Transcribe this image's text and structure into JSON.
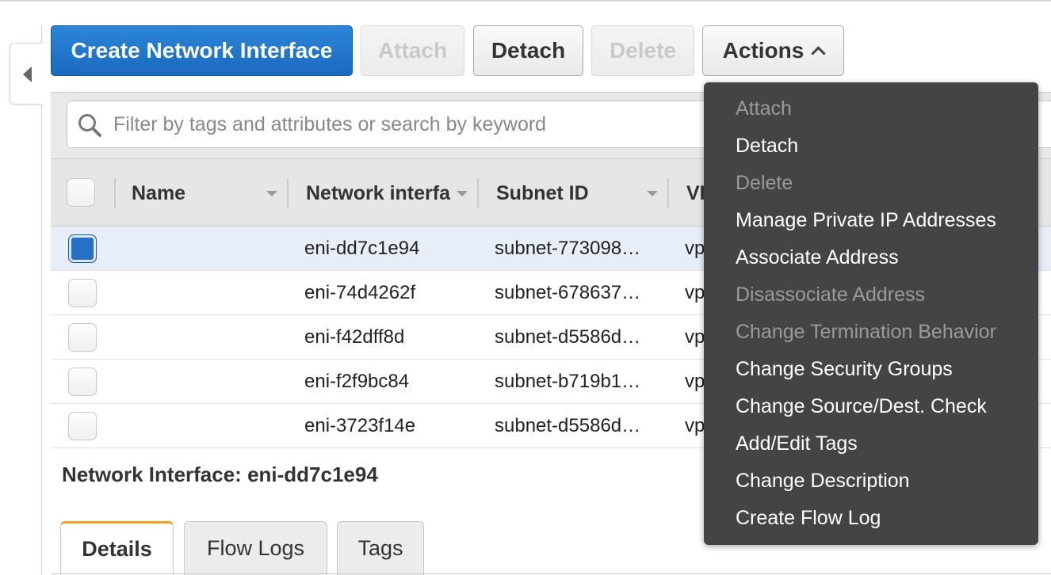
{
  "toolbar": {
    "create_label": "Create Network Interface",
    "attach_label": "Attach",
    "detach_label": "Detach",
    "delete_label": "Delete",
    "actions_label": "Actions"
  },
  "search": {
    "placeholder": "Filter by tags and attributes or search by keyword"
  },
  "table": {
    "columns": [
      "Name",
      "Network interfa",
      "Subnet ID",
      "VI"
    ],
    "rows": [
      {
        "name": "",
        "eni": "eni-dd7c1e94",
        "subnet": "subnet-773098…",
        "vpc": "vp",
        "selected": true
      },
      {
        "name": "",
        "eni": "eni-74d4262f",
        "subnet": "subnet-678637…",
        "vpc": "vp",
        "selected": false
      },
      {
        "name": "",
        "eni": "eni-f42dff8d",
        "subnet": "subnet-d5586d…",
        "vpc": "vp",
        "selected": false
      },
      {
        "name": "",
        "eni": "eni-f2f9bc84",
        "subnet": "subnet-b719b1…",
        "vpc": "vp",
        "selected": false
      },
      {
        "name": "",
        "eni": "eni-3723f14e",
        "subnet": "subnet-d5586d…",
        "vpc": "vp",
        "selected": false
      }
    ]
  },
  "detail": {
    "title": "Network Interface: eni-dd7c1e94",
    "tabs": [
      "Details",
      "Flow Logs",
      "Tags"
    ]
  },
  "actions_menu": {
    "items": [
      {
        "label": "Attach",
        "enabled": false
      },
      {
        "label": "Detach",
        "enabled": true
      },
      {
        "label": "Delete",
        "enabled": false
      },
      {
        "label": "Manage Private IP Addresses",
        "enabled": true
      },
      {
        "label": "Associate Address",
        "enabled": true
      },
      {
        "label": "Disassociate Address",
        "enabled": false
      },
      {
        "label": "Change Termination Behavior",
        "enabled": false
      },
      {
        "label": "Change Security Groups",
        "enabled": true
      },
      {
        "label": "Change Source/Dest. Check",
        "enabled": true
      },
      {
        "label": "Add/Edit Tags",
        "enabled": true
      },
      {
        "label": "Change Description",
        "enabled": true
      },
      {
        "label": "Create Flow Log",
        "enabled": true
      }
    ]
  },
  "colors": {
    "primary_button": "#1a69bf",
    "menu_background": "#444444",
    "active_tab_accent": "#f0a01e",
    "selected_checkbox": "#2671c7"
  }
}
